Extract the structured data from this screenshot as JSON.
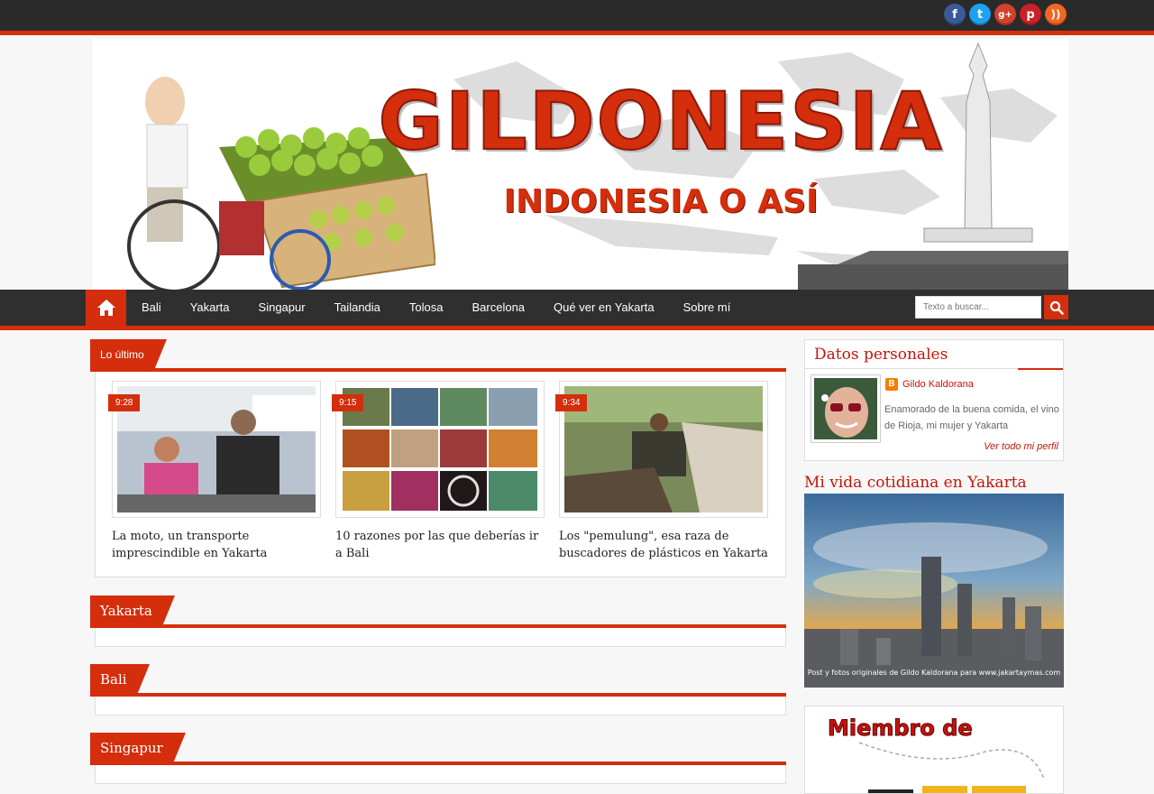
{
  "social": {
    "facebook_glyph": "f",
    "twitter_glyph": "t",
    "googleplus_glyph": "g+",
    "pinterest_glyph": "p",
    "rss_glyph": "))"
  },
  "banner": {
    "title": "GILDONESIA",
    "subtitle": "INDONESIA O ASÍ"
  },
  "nav": {
    "items": [
      "Bali",
      "Yakarta",
      "Singapur",
      "Tailandia",
      "Tolosa",
      "Barcelona",
      "Qué ver en Yakarta",
      "Sobre mí"
    ]
  },
  "search": {
    "placeholder": "Texto a buscar..."
  },
  "sections": {
    "latest": "Lo último",
    "yakarta": "Yakarta",
    "bali": "Bali",
    "singapur": "Singapur"
  },
  "posts": [
    {
      "time": "9:28",
      "title": "La moto, un transporte imprescindible en Yakarta"
    },
    {
      "time": "9:15",
      "title": "10 razones por las que deberías ir a Bali"
    },
    {
      "time": "9:34",
      "title": "Los \"pemulung\", esa raza de buscadores de plásticos en Yakarta"
    }
  ],
  "profile": {
    "widget_title": "Datos personales",
    "name": "Gildo Kaldorana",
    "description": "Enamorado de la buena comida, el vino de Rioja, mi mujer y Yakarta",
    "link": "Ver todo mi perfil"
  },
  "vida": {
    "title": "Mi vida cotidiana en Yakarta",
    "caption": "Post y fotos originales de Gildo Kaldorana para www.jakartaymas.com"
  },
  "member": {
    "text": "Miembro de"
  },
  "colors": {
    "accent": "#d42e0d",
    "dark": "#2f2f2f"
  }
}
